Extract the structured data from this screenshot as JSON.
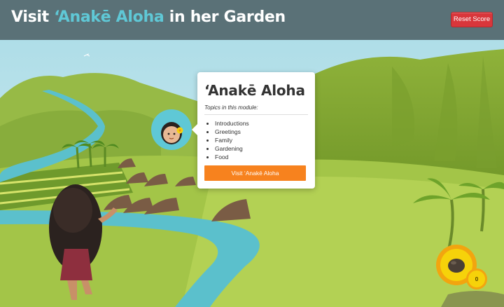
{
  "header": {
    "title_prefix": "Visit ",
    "title_name": "‘Anakē Aloha",
    "title_suffix": " in her Garden",
    "reset_label": "Reset Score"
  },
  "popover": {
    "title": "‘Anakē Aloha",
    "subtitle": "Topics in this module:",
    "topics": [
      "Introductions",
      "Greetings",
      "Family",
      "Gardening",
      "Food"
    ],
    "visit_label": "Visit ‘Anakē Aloha"
  },
  "score": {
    "count": "0"
  },
  "colors": {
    "header_bg": "#54686e",
    "accent_teal": "#5fc8d6",
    "reset_red": "#d9363b",
    "visit_orange": "#f7821e",
    "score_yellow": "#f6d20a"
  }
}
